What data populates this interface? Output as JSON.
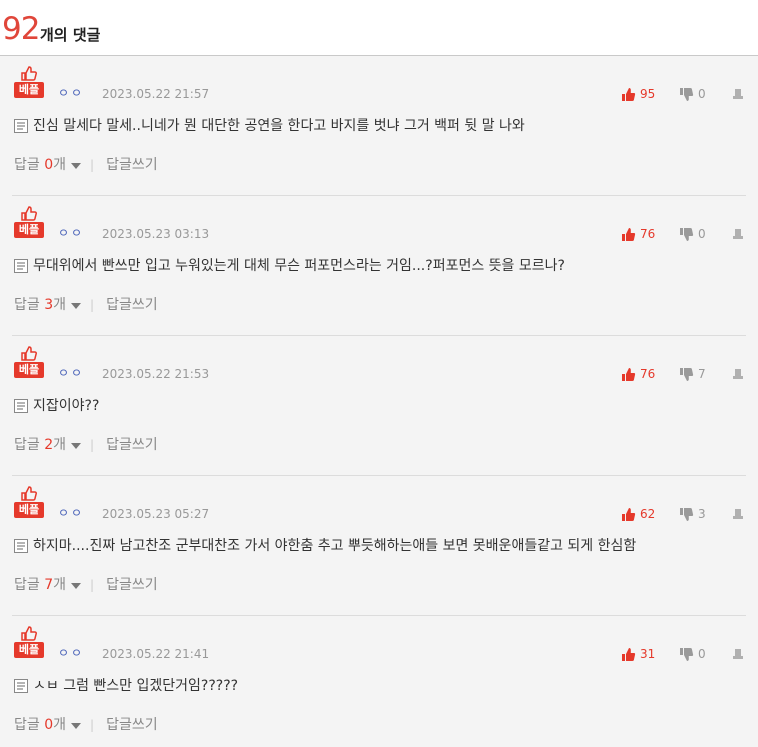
{
  "header": {
    "count": "92",
    "label": "개의 댓글"
  },
  "labels": {
    "best_badge": "베플",
    "reply_prefix": "답글",
    "reply_suffix": "개",
    "write_reply": "답글쓰기"
  },
  "colors": {
    "accent": "#e5392b",
    "nickname": "#4a63b8",
    "meta": "#999999",
    "background": "#f4f4f4"
  },
  "icons": {
    "thumb_badge": "thumbs-up-outline-icon",
    "like": "thumbs-up-icon",
    "dislike": "thumbs-down-icon",
    "report": "report-icon",
    "text": "document-icon",
    "expand": "caret-down-icon"
  },
  "comments": [
    {
      "nickname": "ㅇㅇ",
      "date": "2023.05.22 21:57",
      "likes": "95",
      "dislikes": "0",
      "text": "진심 말세다 말세..니네가 뭔 대단한 공연을 한다고 바지를 벗냐 그거 백퍼 뒷 말 나와",
      "reply_count": "0"
    },
    {
      "nickname": "ㅇㅇ",
      "date": "2023.05.23 03:13",
      "likes": "76",
      "dislikes": "0",
      "text": "무대위에서 빤쓰만 입고 누워있는게 대체 무슨 퍼포먼스라는 거임...?퍼포먼스 뜻을 모르나?",
      "reply_count": "3"
    },
    {
      "nickname": "ㅇㅇ",
      "date": "2023.05.22 21:53",
      "likes": "76",
      "dislikes": "7",
      "text": "지잡이야??",
      "reply_count": "2"
    },
    {
      "nickname": "ㅇㅇ",
      "date": "2023.05.23 05:27",
      "likes": "62",
      "dislikes": "3",
      "text": "하지마....진짜 남고찬조 군부대찬조 가서 야한춤 추고 뿌듯해하는애들 보면 못배운애들같고 되게 한심함",
      "reply_count": "7"
    },
    {
      "nickname": "ㅇㅇ",
      "date": "2023.05.22 21:41",
      "likes": "31",
      "dislikes": "0",
      "text": "ㅅㅂ 그럼 빤스만 입겠단거임?????",
      "reply_count": "0"
    }
  ]
}
